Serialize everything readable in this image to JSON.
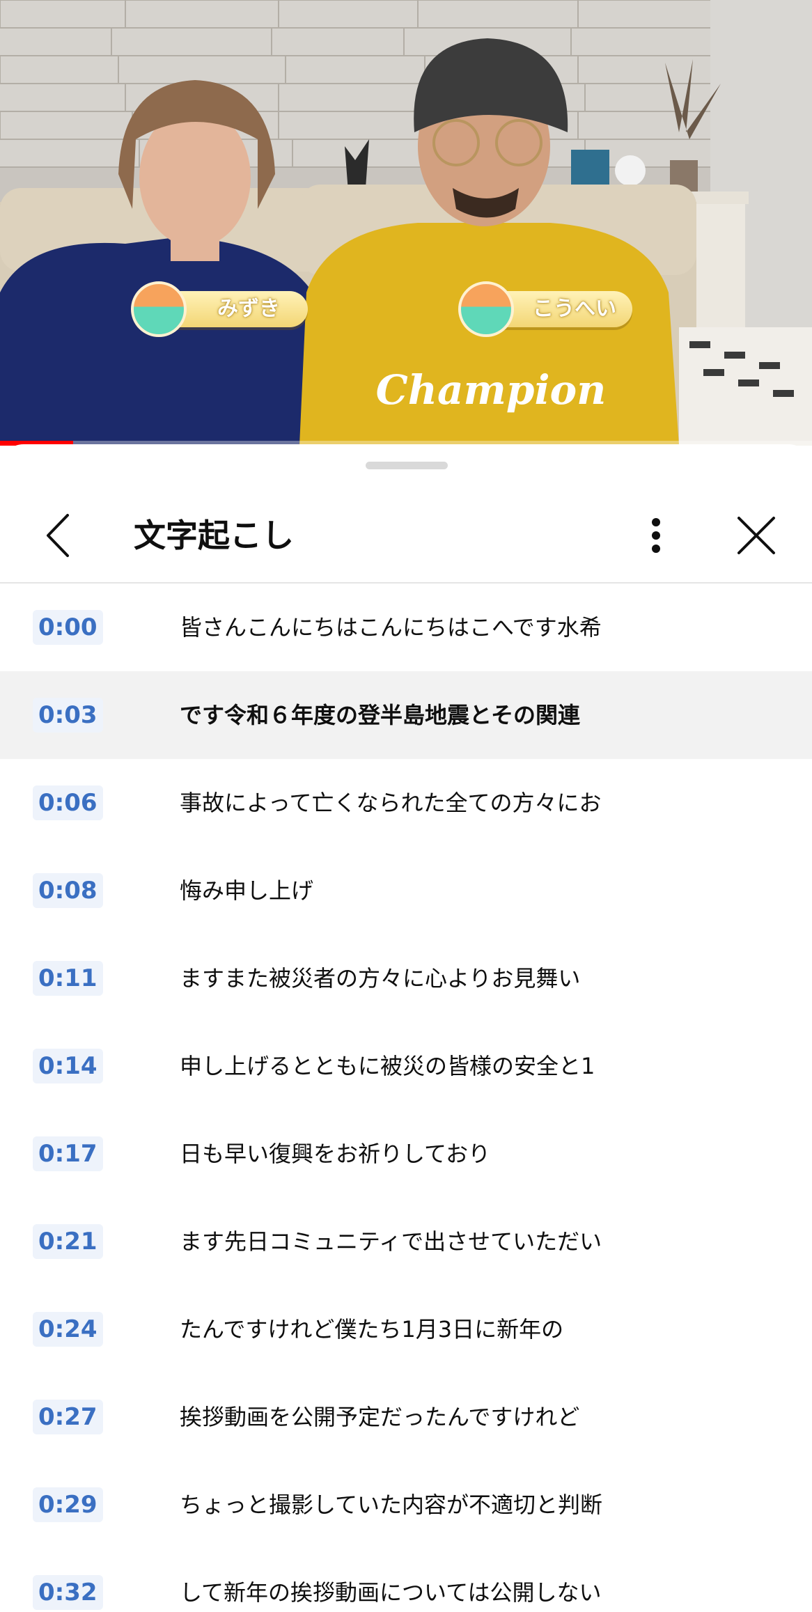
{
  "video": {
    "progress": 0.09,
    "speakers": [
      {
        "name": "みずき"
      },
      {
        "name": "こうへい"
      }
    ],
    "shirt_text": "Champion"
  },
  "panel": {
    "title": "文字起こし",
    "icons": {
      "back": "chevron-left-icon",
      "more": "more-vert-icon",
      "close": "close-icon"
    }
  },
  "transcript": {
    "active_index": 1,
    "segments": [
      {
        "time": "0:00",
        "text": "皆さんこんにちはこんにちはこへです水希"
      },
      {
        "time": "0:03",
        "text": "です令和６年度の登半島地震とその関連"
      },
      {
        "time": "0:06",
        "text": "事故によって亡くなられた全ての方々にお"
      },
      {
        "time": "0:08",
        "text": "悔み申し上げ"
      },
      {
        "time": "0:11",
        "text": "ますまた被災者の方々に心よりお見舞い"
      },
      {
        "time": "0:14",
        "text": "申し上げるとともに被災の皆様の安全と1"
      },
      {
        "time": "0:17",
        "text": "日も早い復興をお祈りしており"
      },
      {
        "time": "0:21",
        "text": "ます先日コミュニティで出させていただい"
      },
      {
        "time": "0:24",
        "text": "たんですけれど僕たち1月3日に新年の"
      },
      {
        "time": "0:27",
        "text": "挨拶動画を公開予定だったんですけれど"
      },
      {
        "time": "0:29",
        "text": "ちょっと撮影していた内容が不適切と判断"
      },
      {
        "time": "0:32",
        "text": "して新年の挨拶動画については公開しない"
      }
    ]
  },
  "colors": {
    "timestamp": "#3a6fc2",
    "timestamp_bg": "#eef3fb",
    "active_row": "#f2f2f2",
    "progress": "#ff0000"
  }
}
